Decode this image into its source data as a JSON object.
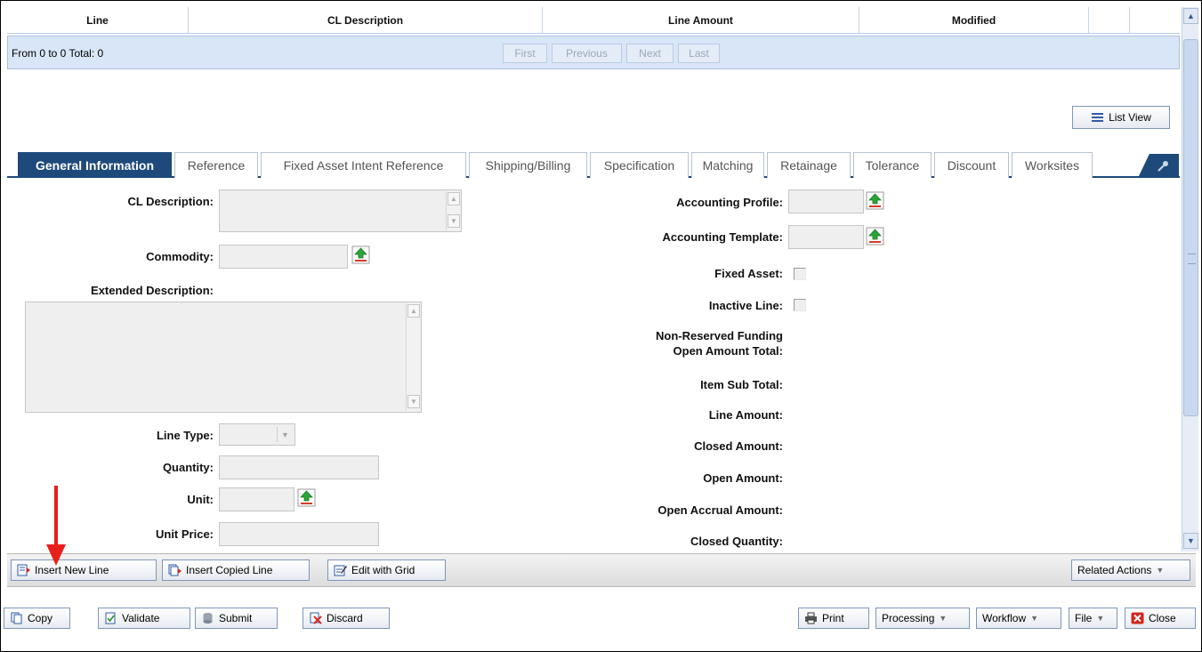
{
  "grid": {
    "columns": [
      "Line",
      "CL Description",
      "Line Amount",
      "Modified"
    ],
    "pager_info": "From 0 to 0 Total: 0",
    "pager_buttons": [
      "First",
      "Previous",
      "Next",
      "Last"
    ]
  },
  "list_view_label": "List View",
  "tabs": [
    "General Information",
    "Reference",
    "Fixed Asset Intent Reference",
    "Shipping/Billing",
    "Specification",
    "Matching",
    "Retainage",
    "Tolerance",
    "Discount",
    "Worksites"
  ],
  "left_form": {
    "cl_description": "CL Description:",
    "commodity": "Commodity:",
    "extended_description": "Extended Description:",
    "line_type": "Line Type:",
    "quantity": "Quantity:",
    "unit": "Unit:",
    "unit_price": "Unit Price:"
  },
  "right_form": {
    "accounting_profile": "Accounting Profile:",
    "accounting_template": "Accounting Template:",
    "fixed_asset": "Fixed Asset:",
    "inactive_line": "Inactive Line:",
    "non_reserved_1": "Non-Reserved Funding",
    "non_reserved_2": "Open Amount Total:",
    "item_sub_total": "Item Sub Total:",
    "line_amount": "Line Amount:",
    "closed_amount": "Closed Amount:",
    "open_amount": "Open Amount:",
    "open_accrual_amount": "Open Accrual Amount:",
    "closed_quantity": "Closed Quantity:"
  },
  "actions": {
    "insert_new_line": "Insert New Line",
    "insert_copied_line": "Insert Copied Line",
    "edit_with_grid": "Edit with Grid",
    "related_actions": "Related Actions"
  },
  "footer": {
    "copy": "Copy",
    "validate": "Validate",
    "submit": "Submit",
    "discard": "Discard",
    "print": "Print",
    "processing": "Processing",
    "workflow": "Workflow",
    "file": "File",
    "close": "Close"
  },
  "colors": {
    "tab_active": "#1e4a7b",
    "pager_bg": "#d9e6f7",
    "annotation_arrow": "#e8201c"
  }
}
